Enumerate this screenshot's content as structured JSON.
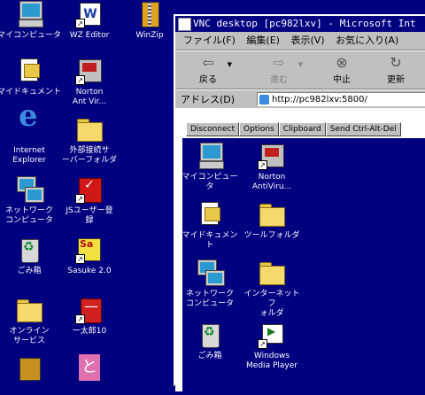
{
  "desktop_icons": [
    {
      "name": "my-computer",
      "label": "マイコンピュータ",
      "glyph": "pc",
      "shortcut": false
    },
    {
      "name": "wz-editor",
      "label": "WZ Editor",
      "glyph": "word",
      "shortcut": true
    },
    {
      "name": "winzip",
      "label": "WinZip",
      "glyph": "winzip",
      "shortcut": false
    },
    {
      "name": "my-documents",
      "label": "マイドキュメント",
      "glyph": "doc",
      "shortcut": false
    },
    {
      "name": "norton-antivirus",
      "label": "Norton\nAnt Vir...",
      "glyph": "app",
      "shortcut": true
    },
    {
      "name": "internet-explorer",
      "label": "Internet\nExplorer",
      "glyph": "ie",
      "shortcut": false
    },
    {
      "name": "external-storage-folder",
      "label": "外部接続サ\nーバーフォルダ",
      "glyph": "folder",
      "shortcut": false
    },
    {
      "name": "network-neighborhood",
      "label": "ネットワーク\nコンピュータ",
      "glyph": "net",
      "shortcut": false
    },
    {
      "name": "js-user-register",
      "label": "JSユーザー登\n録",
      "glyph": "red",
      "shortcut": true
    },
    {
      "name": "recycle-bin",
      "label": "ごみ箱",
      "glyph": "bin",
      "shortcut": false
    },
    {
      "name": "sasuke",
      "label": "Sasuke 2.0",
      "glyph": "sasuke",
      "shortcut": true
    },
    {
      "name": "online-service",
      "label": "オンライン\nサービス",
      "glyph": "folder",
      "shortcut": false
    },
    {
      "name": "ichitaro",
      "label": "一太郎10",
      "glyph": "ichitaro",
      "shortcut": true
    }
  ],
  "browser": {
    "title": "VNC desktop [pc982lxv] - Microsoft Int",
    "menu": [
      "ファイル(F)",
      "編集(E)",
      "表示(V)",
      "お気に入り(A)"
    ],
    "toolbar": {
      "back": "戻る",
      "forward": "進む",
      "stop": "中止",
      "refresh": "更新"
    },
    "address_label": "アドレス(D)",
    "address_value": "http://pc982lxv:5800/"
  },
  "vnc": {
    "buttons": [
      "Disconnect",
      "Options",
      "Clipboard",
      "Send Ctrl-Alt-Del"
    ],
    "icons": [
      {
        "name": "vnc-my-computer",
        "label": "マイコンピュータ",
        "glyph": "pc",
        "shortcut": false
      },
      {
        "name": "vnc-norton-antivirus",
        "label": "Norton\nAntiViru...",
        "glyph": "app",
        "shortcut": true
      },
      {
        "name": "vnc-my-documents",
        "label": "マイドキュメント",
        "glyph": "doc",
        "shortcut": false
      },
      {
        "name": "vnc-tool-folder",
        "label": "ツールフォルダ",
        "glyph": "folder",
        "shortcut": false
      },
      {
        "name": "vnc-network",
        "label": "ネットワーク\nコンピュータ",
        "glyph": "net",
        "shortcut": false
      },
      {
        "name": "vnc-internet-folder",
        "label": "インターネットフ\nォルダ",
        "glyph": "folder",
        "shortcut": false
      },
      {
        "name": "vnc-recycle-bin",
        "label": "ごみ箱",
        "glyph": "bin",
        "shortcut": false
      },
      {
        "name": "vnc-windows-media-player",
        "label": "Windows\nMedia Player",
        "glyph": "wmp",
        "shortcut": true
      }
    ]
  }
}
